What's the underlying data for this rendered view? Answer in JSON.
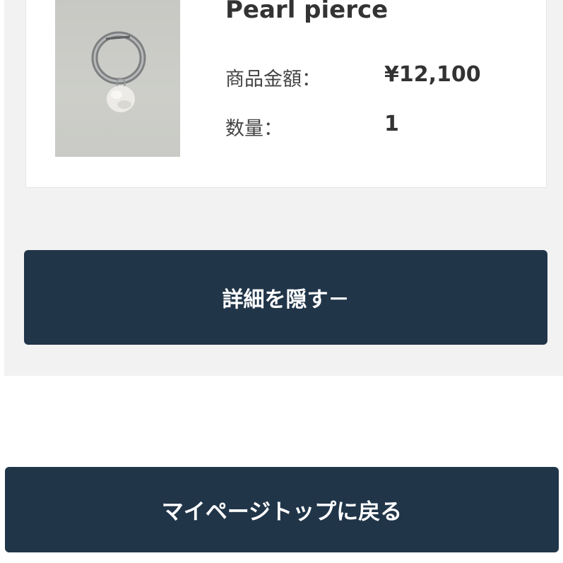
{
  "item": {
    "name": "Pearl pierce",
    "price_label": "商品金額：",
    "price_value": "¥12,100",
    "quantity_label": "数量：",
    "quantity_value": "1"
  },
  "buttons": {
    "hide_details": "詳細を隠す－",
    "back_to_mypage": "マイページトップに戻る"
  },
  "colors": {
    "button_bg": "#213549",
    "section_bg": "#f2f2f2",
    "card_bg": "#ffffff"
  },
  "icons": {
    "product_image": "pearl-hoop-earring-photo"
  }
}
